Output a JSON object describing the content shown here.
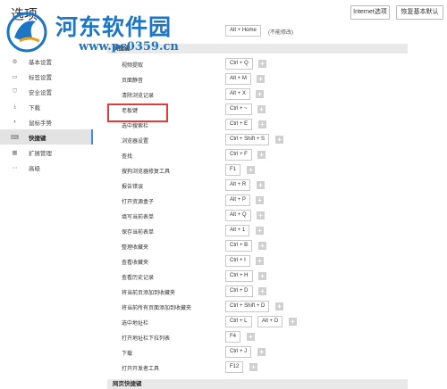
{
  "header": {
    "title": "选项",
    "internet_btn": "Internet选项",
    "reset_btn": "恢复基本默认"
  },
  "watermark": {
    "title": "河东软件园",
    "url": "www.pc0359.cn"
  },
  "sidebar": {
    "items": [
      {
        "label": "基本设置",
        "icon": "gear-icon"
      },
      {
        "label": "标签设置",
        "icon": "tab-icon"
      },
      {
        "label": "安全设置",
        "icon": "shield-icon"
      },
      {
        "label": "下载",
        "icon": "download-icon"
      },
      {
        "label": "鼠标手势",
        "icon": "mouse-icon"
      },
      {
        "label": "快捷键",
        "icon": "keyboard-icon",
        "active": true
      },
      {
        "label": "扩展管理",
        "icon": "extensions-icon"
      },
      {
        "label": "高级",
        "icon": "more-icon"
      }
    ]
  },
  "main": {
    "first_row": {
      "key": "Alt + Home",
      "note": "(不能修改)"
    },
    "section_title": "快捷键",
    "bottom_section_title": "网页快捷键",
    "rows": [
      {
        "name": "视频提取",
        "keys": [
          "Ctrl + Q"
        ]
      },
      {
        "name": "页面静音",
        "keys": [
          "Alt + M"
        ]
      },
      {
        "name": "清除浏览记录",
        "keys": [
          "Alt + X"
        ]
      },
      {
        "name": "老板键",
        "keys": [
          "Ctrl + ~"
        ]
      },
      {
        "name": "选中搜索栏",
        "keys": [
          "Ctrl + E"
        ]
      },
      {
        "name": "浏览器设置",
        "keys": [
          "Ctrl + Shift + S"
        ]
      },
      {
        "name": "查找",
        "keys": [
          "Ctrl + F"
        ]
      },
      {
        "name": "搜狗浏览器修复工具",
        "keys": [
          "F1"
        ]
      },
      {
        "name": "报告错误",
        "keys": [
          "Alt + R"
        ]
      },
      {
        "name": "打开资源盒子",
        "keys": [
          "Alt + P"
        ]
      },
      {
        "name": "填写当前表单",
        "keys": [
          "Alt + Q"
        ]
      },
      {
        "name": "保存当前表单",
        "keys": [
          "Alt + 1"
        ]
      },
      {
        "name": "整理收藏夹",
        "keys": [
          "Ctrl + B"
        ]
      },
      {
        "name": "查看收藏夹",
        "keys": [
          "Ctrl + I"
        ]
      },
      {
        "name": "查看历史记录",
        "keys": [
          "Ctrl + H"
        ]
      },
      {
        "name": "将当前页添加到收藏夹",
        "keys": [
          "Ctrl + D"
        ]
      },
      {
        "name": "将当前所有页面添加到收藏夹",
        "keys": [
          "Ctrl + Shift + D"
        ]
      },
      {
        "name": "选中地址栏",
        "keys": [
          "Ctrl + L",
          "Alt + D"
        ]
      },
      {
        "name": "打开地址栏下拉列表",
        "keys": [
          "F4"
        ]
      },
      {
        "name": "下载",
        "keys": [
          "Ctrl + J"
        ]
      },
      {
        "name": "打开开发者工具",
        "keys": [
          "F12"
        ]
      }
    ]
  },
  "colors": {
    "highlight": "#e23b3b",
    "active_bar": "#3a8ee6",
    "watermark": "#1d76c4"
  }
}
